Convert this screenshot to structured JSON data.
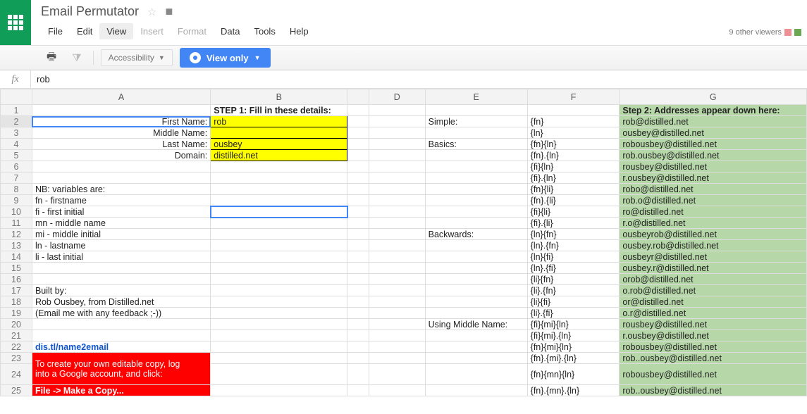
{
  "doc": {
    "title": "Email Permutator"
  },
  "menu": {
    "file": "File",
    "edit": "Edit",
    "view": "View",
    "insert": "Insert",
    "format": "Format",
    "data": "Data",
    "tools": "Tools",
    "help": "Help"
  },
  "viewers": {
    "text": "9 other viewers"
  },
  "toolbar": {
    "accessibility_label": "Accessibility",
    "view_only_label": "View only"
  },
  "formula": {
    "value": "rob"
  },
  "cols": {
    "A": "A",
    "B": "B",
    "C": "",
    "D": "D",
    "E": "E",
    "F": "F",
    "G": "G"
  },
  "step1_header": "STEP 1: Fill in these details:",
  "step2_header": "Step 2: Addresses appear down here:",
  "labels": {
    "first": "First Name:",
    "middle": "Middle Name:",
    "last": "Last Name:",
    "domain": "Domain:"
  },
  "inputs": {
    "first": "rob",
    "middle": "",
    "last": "ousbey",
    "domain": "distilled.net"
  },
  "nb": {
    "l8": "NB: variables are:",
    "l9": "fn - firstname",
    "l10": "fi - first initial",
    "l11": "mn - middle name",
    "l12": "mi - middle initial",
    "l13": "ln - lastname",
    "l14": "li - last initial"
  },
  "built": {
    "l17": "Built by:",
    "l18": "Rob Ousbey, from Distilled.net",
    "l19": "(Email me with any feedback ;-))",
    "l22": "dis.tl/name2email"
  },
  "copynote": {
    "a": "To create your own editable copy, log",
    "b": "into a Google account, and click:",
    "c": "File -> Make a Copy..."
  },
  "colE": {
    "r2": "Simple:",
    "r4": "Basics:",
    "r12": "Backwards:",
    "r20": "Using Middle Name:"
  },
  "colF": {
    "r2": "{fn}",
    "r3": "{ln}",
    "r4": "{fn}{ln}",
    "r5": "{fn}.{ln}",
    "r6": "{fi}{ln}",
    "r7": "{fi}.{ln}",
    "r8": "{fn}{li}",
    "r9": "{fn}.{li}",
    "r10": "{fi}{li}",
    "r11": "{fi}.{li}",
    "r12": "{ln}{fn}",
    "r13": "{ln}.{fn}",
    "r14": "{ln}{fi}",
    "r15": "{ln}.{fi}",
    "r16": "{li}{fn}",
    "r17": "{li}.{fn}",
    "r18": "{li}{fi}",
    "r19": "{li}.{fi}",
    "r20": "{fi}{mi}{ln}",
    "r21": "{fi}{mi}.{ln}",
    "r22": "{fn}{mi}{ln}",
    "r23": "{fn}.{mi}.{ln}",
    "r24": "{fn}{mn}{ln}",
    "r25": "{fn}.{mn}.{ln}"
  },
  "colG": {
    "r2": "rob@distilled.net",
    "r3": "ousbey@distilled.net",
    "r4": "robousbey@distilled.net",
    "r5": "rob.ousbey@distilled.net",
    "r6": "rousbey@distilled.net",
    "r7": "r.ousbey@distilled.net",
    "r8": "robo@distilled.net",
    "r9": "rob.o@distilled.net",
    "r10": "ro@distilled.net",
    "r11": "r.o@distilled.net",
    "r12": "ousbeyrob@distilled.net",
    "r13": "ousbey.rob@distilled.net",
    "r14": "ousbeyr@distilled.net",
    "r15": "ousbey.r@distilled.net",
    "r16": "orob@distilled.net",
    "r17": "o.rob@distilled.net",
    "r18": "or@distilled.net",
    "r19": "o.r@distilled.net",
    "r20": "rousbey@distilled.net",
    "r21": "r.ousbey@distilled.net",
    "r22": "robousbey@distilled.net",
    "r23": "rob..ousbey@distilled.net",
    "r24": "robousbey@distilled.net",
    "r25": "rob..ousbey@distilled.net"
  }
}
